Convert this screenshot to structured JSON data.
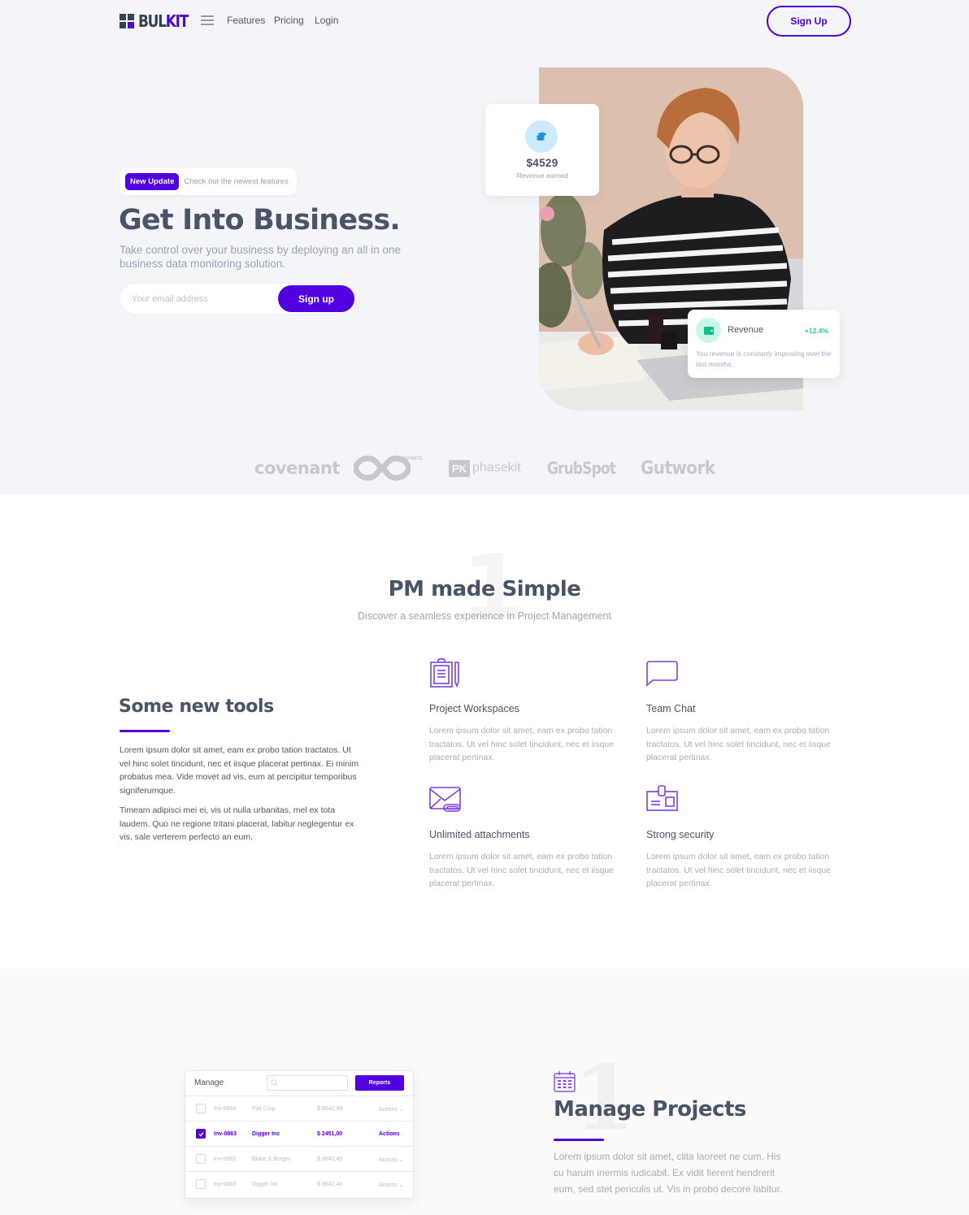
{
  "nav": {
    "logo": {
      "part1": "BUL",
      "part2": "KIT"
    },
    "links": [
      "Features",
      "Pricing",
      "Login"
    ],
    "signup_label": "Sign Up"
  },
  "hero": {
    "badge": "New Update",
    "badge_text": "Check out the newest features",
    "title": "Get Into Business.",
    "subtitle": "Take control over your business by deploying an all in one business data monitoring solution.",
    "email_placeholder": "Your email address",
    "email_value": "",
    "signup_label": "Sign up",
    "revenue_card": {
      "amount": "$4529",
      "label": "Revenue earned",
      "icon": "coins-icon"
    },
    "growth_card": {
      "title": "Revenue",
      "change": "+12.4%",
      "description": "You revenue is constanly improving over the last months.",
      "icon": "wallet-icon"
    }
  },
  "clients": [
    "covenant",
    "INFINITE",
    "phasekit",
    "GrubSpot",
    "Gutwork"
  ],
  "features_section": {
    "number": "1",
    "title": "PM made Simple",
    "subtitle": "Discover a seamless experience in Project Management",
    "intro": {
      "title": "Some new tools",
      "paragraphs": [
        "Lorem ipsum dolor sit amet, eam ex probo tation tractatos. Ut vel hinc solet tincidunt, nec et iisque placerat pertinax. Ei minim probatus mea. Vide movet ad vis, eum at percipitur temporibus signiferumque.",
        "Timeam adipisci mei ei, vis ut nulla urbanitas, mel ex tota laudem. Quo ne regione tritani placerat, labitur neglegentur ex vis, sale verterem perfecto an eum."
      ]
    },
    "items": [
      {
        "title": "Project Workspaces",
        "icon": "clipboard-icon",
        "description": "Lorem ipsum dolor sit amet, eam ex probo tation tractatos. Ut vel hinc solet tincidunt, nec et iisque placerat pertinax."
      },
      {
        "title": "Team Chat",
        "icon": "chat-bubble-icon",
        "description": "Lorem ipsum dolor sit amet, eam ex probo tation tractatos. Ut vel hinc solet tincidunt, nec et iisque placerat pertinax."
      },
      {
        "title": "Unlimited attachments",
        "icon": "mail-attachment-icon",
        "description": "Lorem ipsum dolor sit amet, eam ex probo tation tractatos. Ut vel hinc solet tincidunt, nec et iisque placerat pertinax."
      },
      {
        "title": "Strong security",
        "icon": "id-badge-icon",
        "description": "Lorem ipsum dolor sit amet, eam ex probo tation tractatos. Ut vel hinc solet tincidunt, nec et iisque placerat pertinax."
      }
    ]
  },
  "manage_section": {
    "number": "1",
    "title": "Manage Projects",
    "description": "Lorem ipsum dolor sit amet, clita laoreet ne cum. His cu harum inermis iudicabit. Ex vidit fierent hendrerit eum, sed stet periculis ut. Vis in probo decore labitur.",
    "table": {
      "title": "Manage",
      "search_value": "",
      "reports_label": "Reports",
      "rows": [
        {
          "invoice": "Inv-0864",
          "company": "Flat Corp",
          "amount": "$ 8642,49",
          "action": "Actions",
          "checked": false
        },
        {
          "invoice": "Inv-0863",
          "company": "Digger Inc",
          "amount": "$ 2451,00",
          "action": "Actions",
          "checked": true
        },
        {
          "invoice": "Inv-0862",
          "company": "Blake & Burger",
          "amount": "$ 8642,49",
          "action": "Actions",
          "checked": false
        },
        {
          "invoice": "Inv-0863",
          "company": "Digger Inc",
          "amount": "$ 8642,49",
          "action": "Actions",
          "checked": false
        }
      ]
    }
  },
  "colors": {
    "primary": "#5200e0",
    "heading": "#4a5468",
    "success": "#1ccf9c",
    "hero_bg": "#f4f5f9"
  }
}
